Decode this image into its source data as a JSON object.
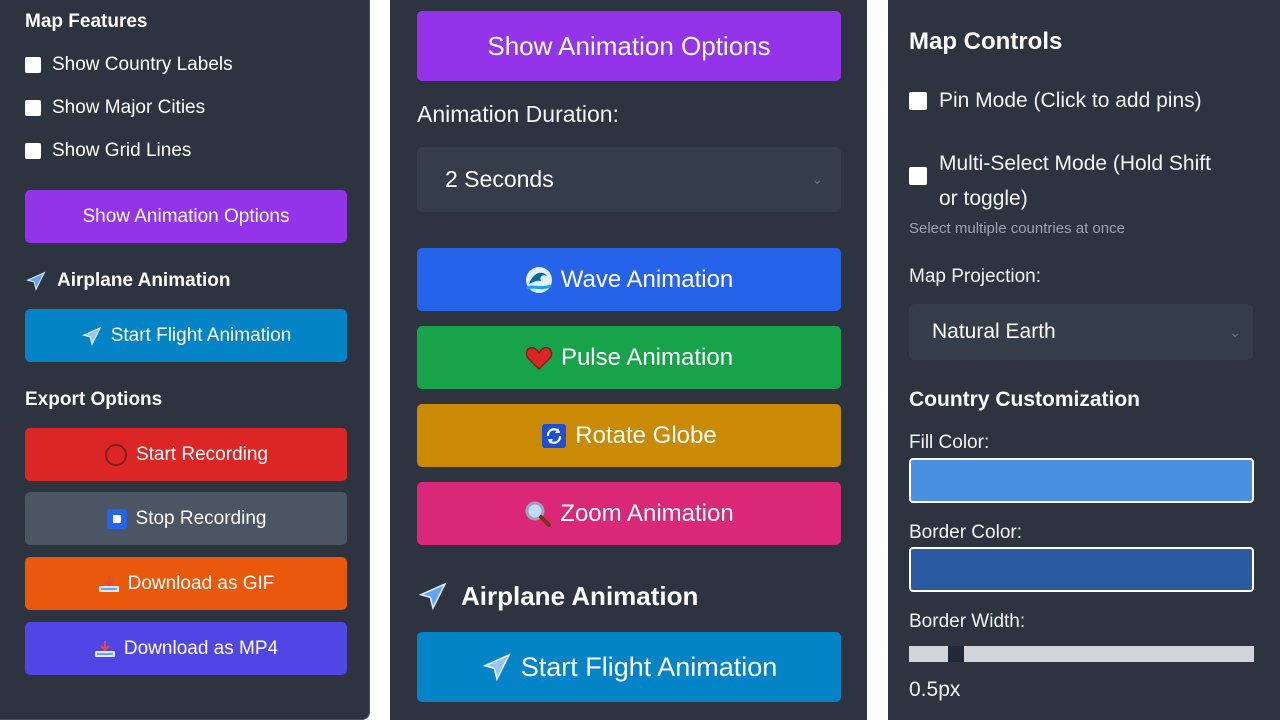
{
  "left_panel": {
    "map_features_title": "Map Features",
    "checkboxes": [
      {
        "label": "Show Country Labels",
        "checked": false
      },
      {
        "label": "Show Major Cities",
        "checked": false
      },
      {
        "label": "Show Grid Lines",
        "checked": false
      }
    ],
    "show_animation_options_label": "Show Animation Options",
    "airplane_title": "Airplane Animation",
    "start_flight_label": "Start Flight Animation",
    "export_title": "Export Options",
    "start_recording_label": "Start Recording",
    "stop_recording_label": "Stop Recording",
    "download_gif_label": "Download as GIF",
    "download_mp4_label": "Download as MP4"
  },
  "middle_panel": {
    "show_animation_options_label": "Show Animation Options",
    "duration_label": "Animation Duration:",
    "duration_value": "2 Seconds",
    "wave_label": "Wave Animation",
    "pulse_label": "Pulse Animation",
    "rotate_label": "Rotate Globe",
    "zoom_label": "Zoom Animation",
    "airplane_title": "Airplane Animation",
    "start_flight_label": "Start Flight Animation"
  },
  "right_panel": {
    "map_controls_title": "Map Controls",
    "pin_mode_label": "Pin Mode (Click to add pins)",
    "pin_mode_checked": false,
    "multi_select_label_line1": "Multi-Select Mode (Hold Shift",
    "multi_select_label_line2": "or toggle)",
    "multi_select_checked": false,
    "multi_select_hint": "Select multiple countries at once",
    "projection_label": "Map Projection:",
    "projection_value": "Natural Earth",
    "customization_title": "Country Customization",
    "fill_color_label": "Fill Color:",
    "fill_color": "#4a90e2",
    "border_color_label": "Border Color:",
    "border_color": "#2b5aa3",
    "border_width_label": "Border Width:",
    "border_width_value": "0.5px",
    "border_width_fraction": 0.12
  },
  "colors": {
    "panel_bg": "#2d3440",
    "purple": "#9333ea",
    "sky": "#0284c7",
    "red": "#dc2626",
    "slate": "#4b5563",
    "orange": "#ea580c",
    "indigo": "#4f46e5",
    "blue": "#2563eb",
    "green": "#16a34a",
    "amber": "#ca8a04",
    "pink": "#db2777"
  },
  "icons": {
    "airplane": "airplane-icon",
    "record": "record-circle-icon",
    "stop": "stop-square-icon",
    "download": "download-tray-icon",
    "wave": "wave-icon",
    "heart": "heart-icon",
    "rotate": "rotate-arrows-icon",
    "zoom": "magnifier-icon"
  }
}
